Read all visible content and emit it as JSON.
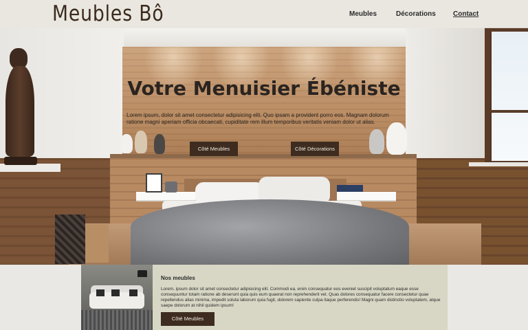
{
  "header": {
    "logo": "Meubles Bô",
    "nav": [
      {
        "label": "Meubles"
      },
      {
        "label": "Décorations"
      },
      {
        "label": "Contact"
      }
    ]
  },
  "hero": {
    "title": "Votre Menuisier Ébéniste",
    "text": "Lorem ipsum, dolor sit amet consectetur adipisicing elit. Quo ipsam a provident porro eos. Magnam dolorum ratione magni aperiam officia obcaecati, cupiditate rem illum temporibus veritatis veniam dolor ut alias.",
    "buttons": [
      {
        "label": "Côté Meubles"
      },
      {
        "label": "Côté Décorations"
      }
    ]
  },
  "section": {
    "title": "Nos meubles",
    "text": "Lorem, ipsum dolor sit amet consectetur adipisicing elit. Commodi ea, enim consequatur eos eveniet suscipit voluptatum eaque esse consequuntur totam ratione ab deserunt quia quis eum quaerat non reprehenderit vel. Quas dolores consequatur facere consectetur quae repellendus alias minima, impedit soluta laborum quia fugit, dolorem sapiente culpa itaque perferendis! Magni quam distinctio voluptatem, atque saepe dolorum at nihil quidem ipsum!",
    "button": "Côté Meubles"
  },
  "colors": {
    "header_bg": "#e8e6de",
    "button_bg": "#3d2c1f",
    "button_text": "#f3ece3",
    "section_bg": "#d8d7c5"
  }
}
